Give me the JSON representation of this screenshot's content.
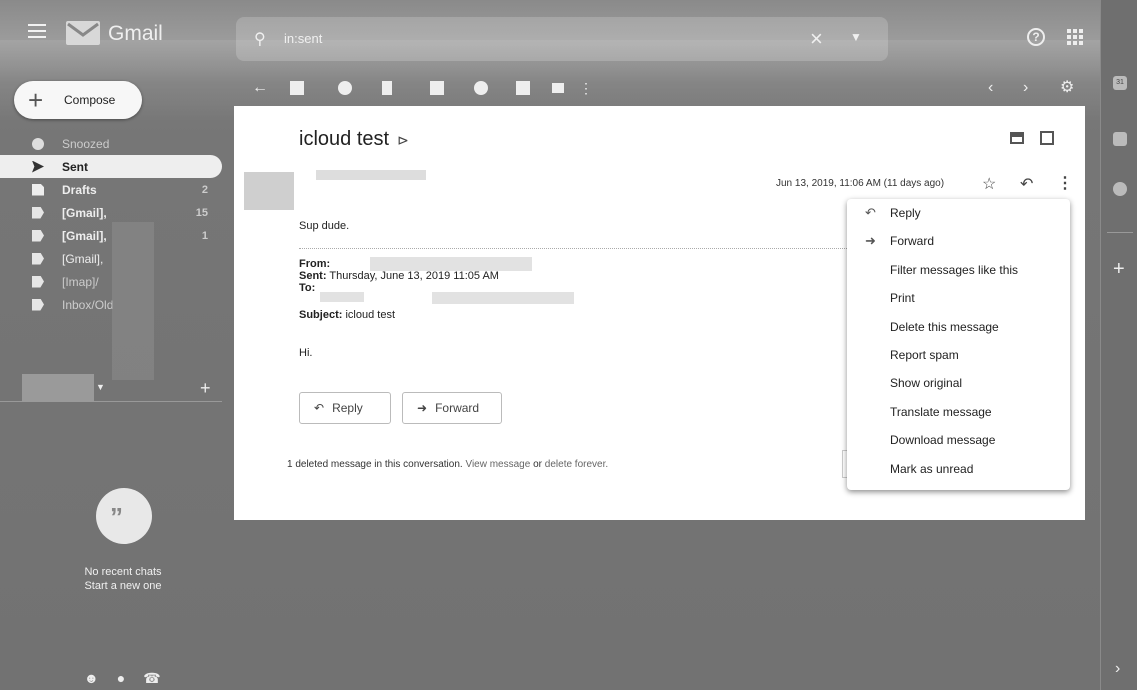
{
  "app": {
    "name": "Gmail"
  },
  "search": {
    "value": "in:sent"
  },
  "compose": {
    "label": "Compose"
  },
  "nav": {
    "items": [
      {
        "label": "Snoozed",
        "count": ""
      },
      {
        "label": "Sent",
        "count": ""
      },
      {
        "label": "Drafts",
        "count": "2"
      },
      {
        "label": "[Gmail],",
        "count": "15"
      },
      {
        "label": "[Gmail],",
        "count": "1"
      },
      {
        "label": "[Gmail],",
        "count": ""
      },
      {
        "label": "[Imap]/",
        "count": ""
      },
      {
        "label": "Inbox/Old",
        "count": ""
      }
    ]
  },
  "chat": {
    "line1": "No recent chats",
    "line2": "Start a new one"
  },
  "rail": {
    "calendar_day": "31"
  },
  "email": {
    "subject": "icloud test",
    "date": "Jun 13, 2019, 11:06 AM (11 days ago)",
    "body": "Sup dude.",
    "quoted": {
      "from_label": "From:",
      "sent_label": "Sent:",
      "sent_value": "Thursday, June 13, 2019 11:05 AM",
      "to_label": "To:",
      "subject_label": "Subject:",
      "subject_value": "icloud test",
      "greeting": "Hi."
    },
    "buttons": {
      "reply": "Reply",
      "forward": "Forward"
    },
    "deleted_note": {
      "text": "1 deleted message in this conversation.",
      "view": "View message",
      "or": "or",
      "delete": "delete forever."
    }
  },
  "menu": {
    "items": [
      "Reply",
      "Forward",
      "Filter messages like this",
      "Print",
      "Delete this message",
      "Report spam",
      "Show original",
      "Translate message",
      "Download message",
      "Mark as unread"
    ]
  }
}
